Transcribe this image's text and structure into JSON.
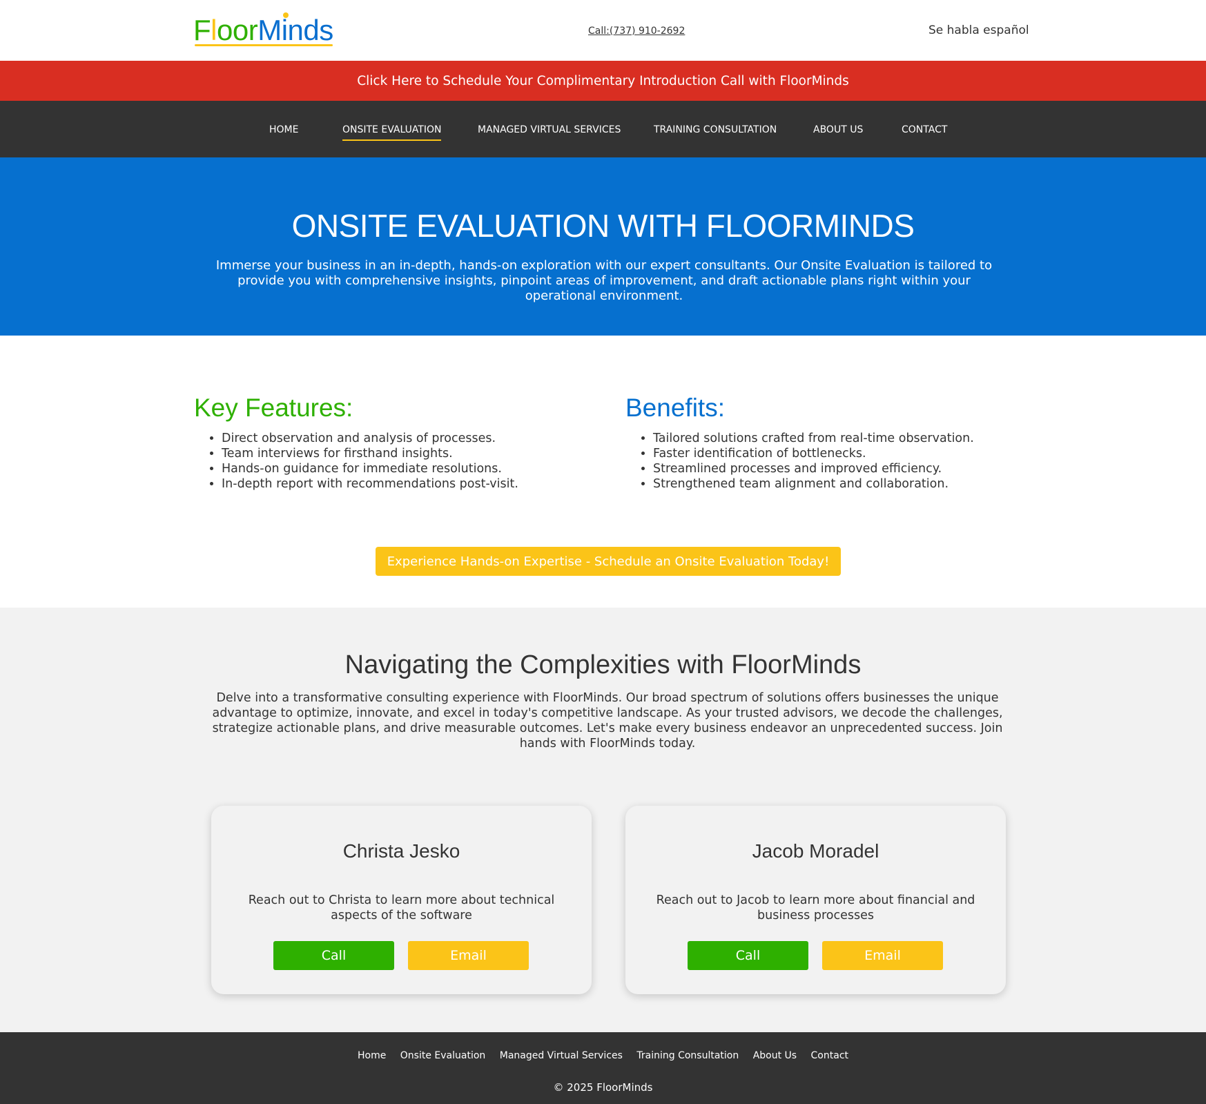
{
  "header": {
    "logo": {
      "part1": "F",
      "part2": "l",
      "part3": "oor",
      "part4": "Minds"
    },
    "call_text": "Call:(737) 910-2692",
    "language_note": "Se habla español"
  },
  "banner": {
    "text": "Click Here to Schedule Your Complimentary Introduction Call with FloorMinds"
  },
  "nav": {
    "items": [
      {
        "label": "HOME"
      },
      {
        "label": "ONSITE EVALUATION"
      },
      {
        "label": "MANAGED VIRTUAL SERVICES"
      },
      {
        "label": "TRAINING CONSULTATION"
      },
      {
        "label": "ABOUT US"
      },
      {
        "label": "CONTACT"
      }
    ],
    "active_color": "#fbc418"
  },
  "hero": {
    "title": "ONSITE EVALUATION WITH FLOORMINDS",
    "description": "Immerse your business in an in-depth, hands-on exploration with our expert consultants. Our Onsite Evaluation is tailored to provide you with comprehensive insights, pinpoint areas of improvement, and draft actionable plans right within your operational environment."
  },
  "key_features": {
    "heading": "Key Features:",
    "items": [
      "Direct observation and analysis of processes.",
      "Team interviews for firsthand insights.",
      "Hands-on guidance for immediate resolutions.",
      "In-depth report with recommendations post-visit."
    ]
  },
  "benefits": {
    "heading": "Benefits:",
    "items": [
      "Tailored solutions crafted from real-time observation.",
      "Faster identification of bottlenecks.",
      "Streamlined processes and improved efficiency.",
      "Strengthened team alignment and collaboration."
    ]
  },
  "cta": {
    "label": "Experience Hands-on Expertise - Schedule an Onsite Evaluation Today!"
  },
  "navigating": {
    "title": "Navigating the Complexities with FloorMinds",
    "text": "Delve into a transformative consulting experience with FloorMinds. Our broad spectrum of solutions offers businesses the unique advantage to optimize, innovate, and excel in today's competitive landscape. As your trusted advisors, we decode the challenges, strategize actionable plans, and drive measurable outcomes. Let's make every business endeavor an unprecedented success. Join hands with FloorMinds today."
  },
  "contacts": [
    {
      "name": "Christa Jesko",
      "description": "Reach out to Christa to learn more about technical aspects of the software",
      "call_label": "Call",
      "email_label": "Email"
    },
    {
      "name": "Jacob Moradel",
      "description": "Reach out to Jacob to learn more about financial and business processes",
      "call_label": "Call",
      "email_label": "Email"
    }
  ],
  "footer": {
    "links": [
      "Home",
      "Onsite Evaluation",
      "Managed Virtual Services",
      "Training Consultation",
      "About Us",
      "Contact"
    ],
    "copyright": "© 2025 FloorMinds"
  },
  "colors": {
    "brand_green": "#2eb000",
    "brand_yellow": "#fbc418",
    "brand_blue": "#0670cf",
    "banner_red": "#d92e22",
    "dark_gray": "#333333",
    "light_gray": "#f2f2f2"
  }
}
